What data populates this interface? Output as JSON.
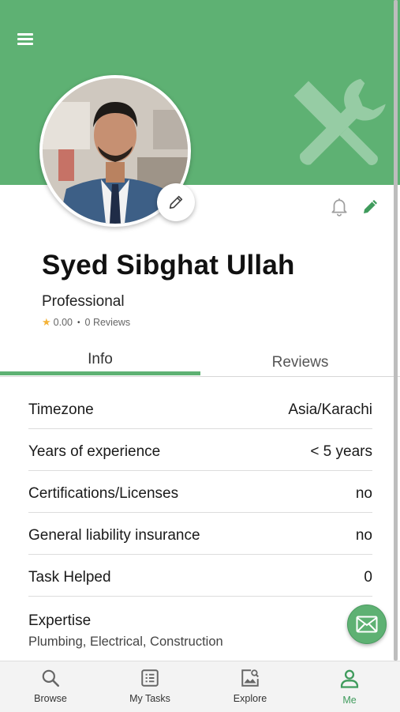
{
  "header": {
    "menu_icon": "menu-icon",
    "background_icon": "tools-icon",
    "accent_color": "#5eb173"
  },
  "profile": {
    "name": "Syed Sibghat Ullah",
    "role": "Professional",
    "rating": "0.00",
    "reviews": "0 Reviews",
    "rating_icon": "star-icon",
    "edit_photo_icon": "pencil-icon",
    "notification_icon": "bell-icon",
    "edit_profile_icon": "pencil-icon"
  },
  "tabs": [
    {
      "label": "Info",
      "active": true
    },
    {
      "label": "Reviews",
      "active": false
    }
  ],
  "info": [
    {
      "label": "Timezone",
      "value": "Asia/Karachi"
    },
    {
      "label": "Years of experience",
      "value": "< 5 years"
    },
    {
      "label": "Certifications/Licenses",
      "value": "no"
    },
    {
      "label": "General liability insurance",
      "value": "no"
    },
    {
      "label": "Task Helped",
      "value": "0"
    }
  ],
  "expertise": {
    "label": "Expertise",
    "value": "Plumbing, Electrical, Construction"
  },
  "fab_icon": "mail-icon",
  "nav": [
    {
      "label": "Browse",
      "icon": "search-icon",
      "active": false
    },
    {
      "label": "My Tasks",
      "icon": "list-icon",
      "active": false
    },
    {
      "label": "Explore",
      "icon": "image-search-icon",
      "active": false
    },
    {
      "label": "Me",
      "icon": "person-icon",
      "active": true
    }
  ]
}
